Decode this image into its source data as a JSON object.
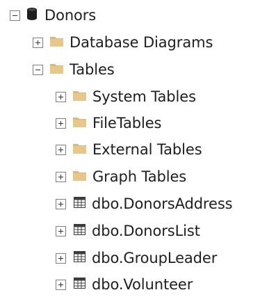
{
  "tree": {
    "root": {
      "label": "Donors",
      "icon": "database-icon",
      "expanded": true
    },
    "nodes": [
      {
        "label": "Database Diagrams",
        "icon": "folder-icon",
        "expanded": false
      },
      {
        "label": "Tables",
        "icon": "folder-icon",
        "expanded": true
      },
      {
        "label": "System Tables",
        "icon": "folder-icon",
        "expanded": false
      },
      {
        "label": "FileTables",
        "icon": "folder-icon",
        "expanded": false
      },
      {
        "label": "External Tables",
        "icon": "folder-icon",
        "expanded": false
      },
      {
        "label": "Graph Tables",
        "icon": "folder-icon",
        "expanded": false
      },
      {
        "label": "dbo.DonorsAddress",
        "icon": "table-icon",
        "expanded": false
      },
      {
        "label": "dbo.DonorsList",
        "icon": "table-icon",
        "expanded": false
      },
      {
        "label": "dbo.GroupLeader",
        "icon": "table-icon",
        "expanded": false
      },
      {
        "label": "dbo.Volunteer",
        "icon": "table-icon",
        "expanded": false
      }
    ]
  },
  "colors": {
    "folder": "#dcb67a",
    "database": "#1e1e1e",
    "table": "#3c3c3c",
    "expander_border": "#7f7f7f",
    "text": "#1e1e1e"
  }
}
